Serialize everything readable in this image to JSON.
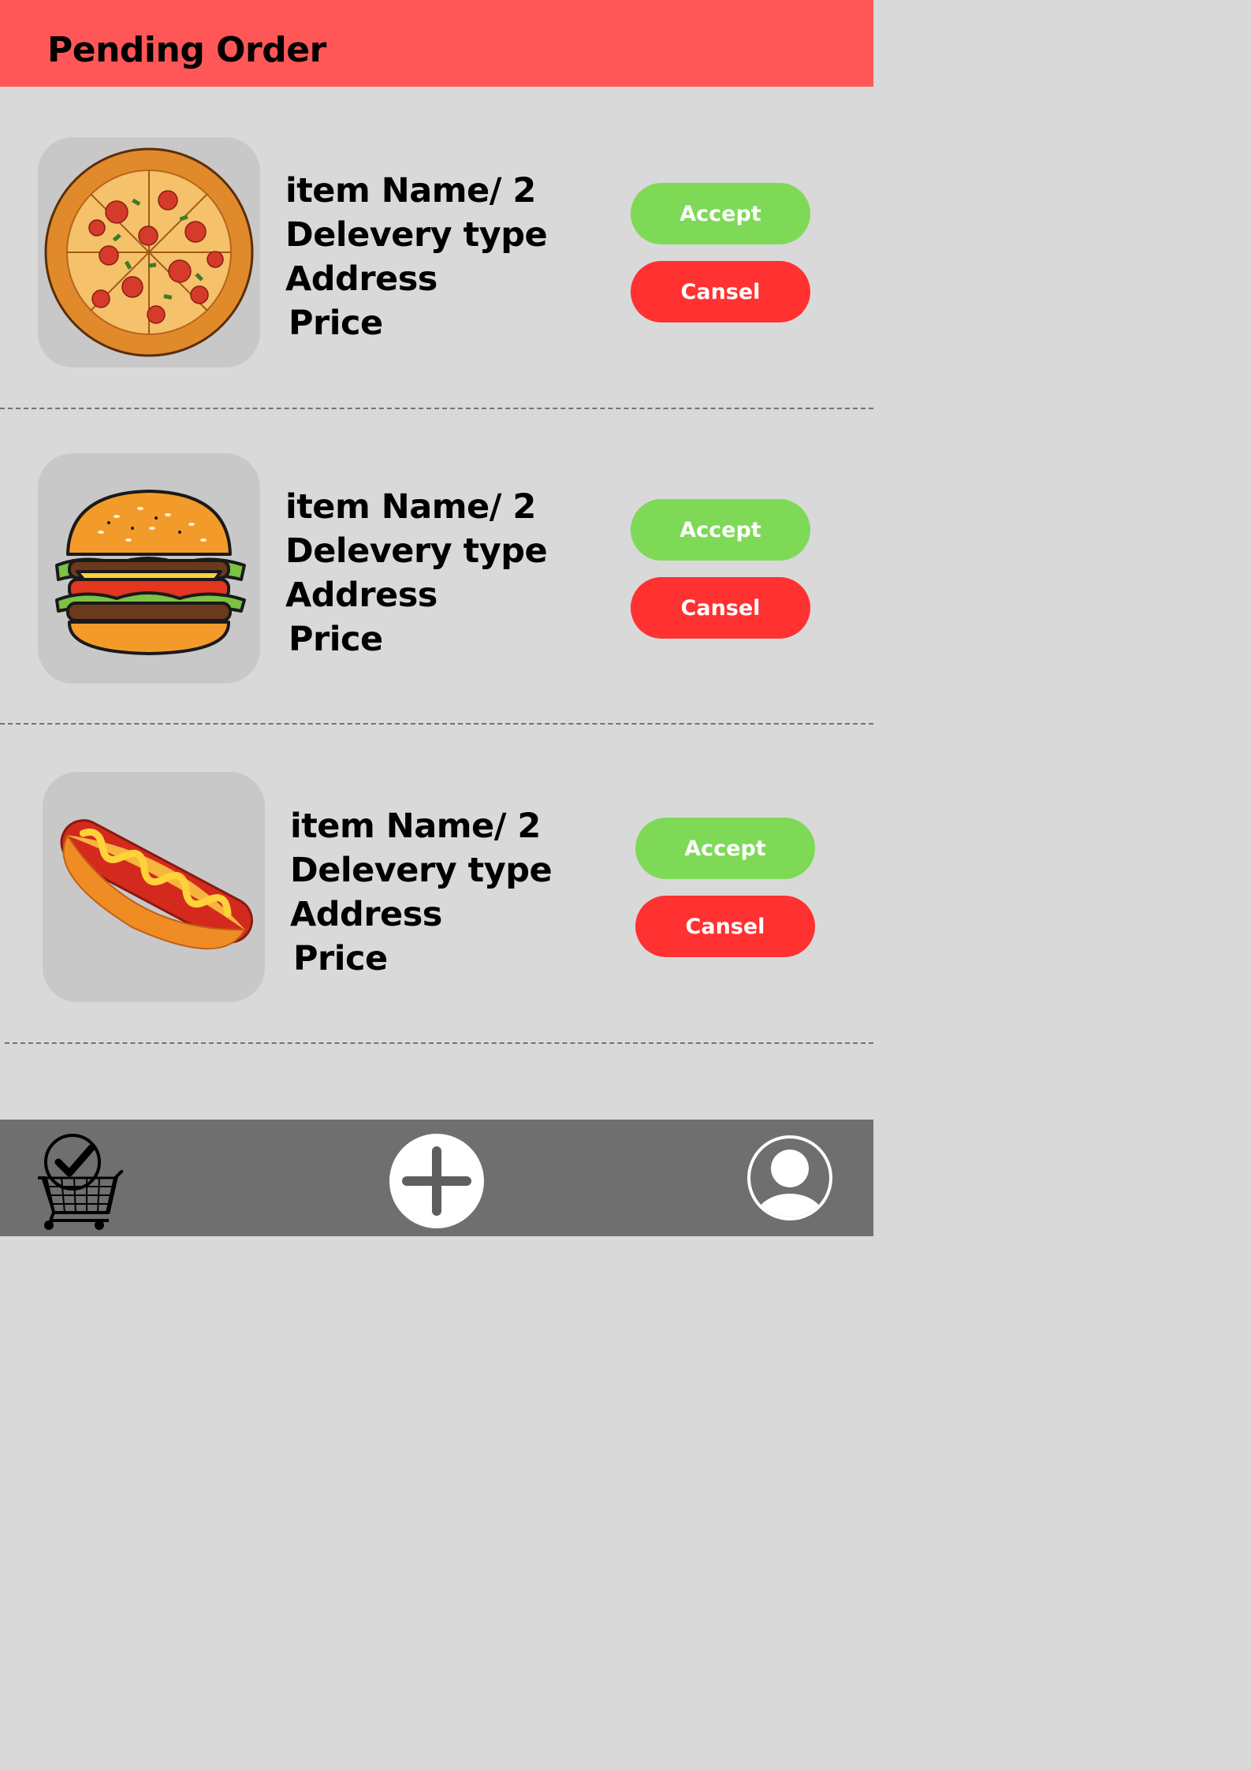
{
  "header": {
    "title": "Pending Order"
  },
  "orders": [
    {
      "image": "pizza-image",
      "item_name": "item Name/ 2",
      "delivery_type": "Delevery type",
      "address": "Address",
      "price": "Price",
      "accept_label": "Accept",
      "cancel_label": "Cansel"
    },
    {
      "image": "burger-image",
      "item_name": "item Name/ 2",
      "delivery_type": "Delevery type",
      "address": "Address",
      "price": "Price",
      "accept_label": "Accept",
      "cancel_label": "Cansel"
    },
    {
      "image": "hotdog-image",
      "item_name": "item Name/ 2",
      "delivery_type": "Delevery type",
      "address": "Address",
      "price": "Price",
      "accept_label": "Accept",
      "cancel_label": "Cansel"
    }
  ],
  "bottom_nav": {
    "items": [
      {
        "icon": "cart-check-icon"
      },
      {
        "icon": "plus-icon"
      },
      {
        "icon": "profile-icon"
      }
    ]
  },
  "colors": {
    "header": "#ff5757",
    "accept": "#7ed957",
    "cancel": "#ff3131",
    "background": "#d9d9d9",
    "bottom_bar": "#6f6f6f"
  }
}
